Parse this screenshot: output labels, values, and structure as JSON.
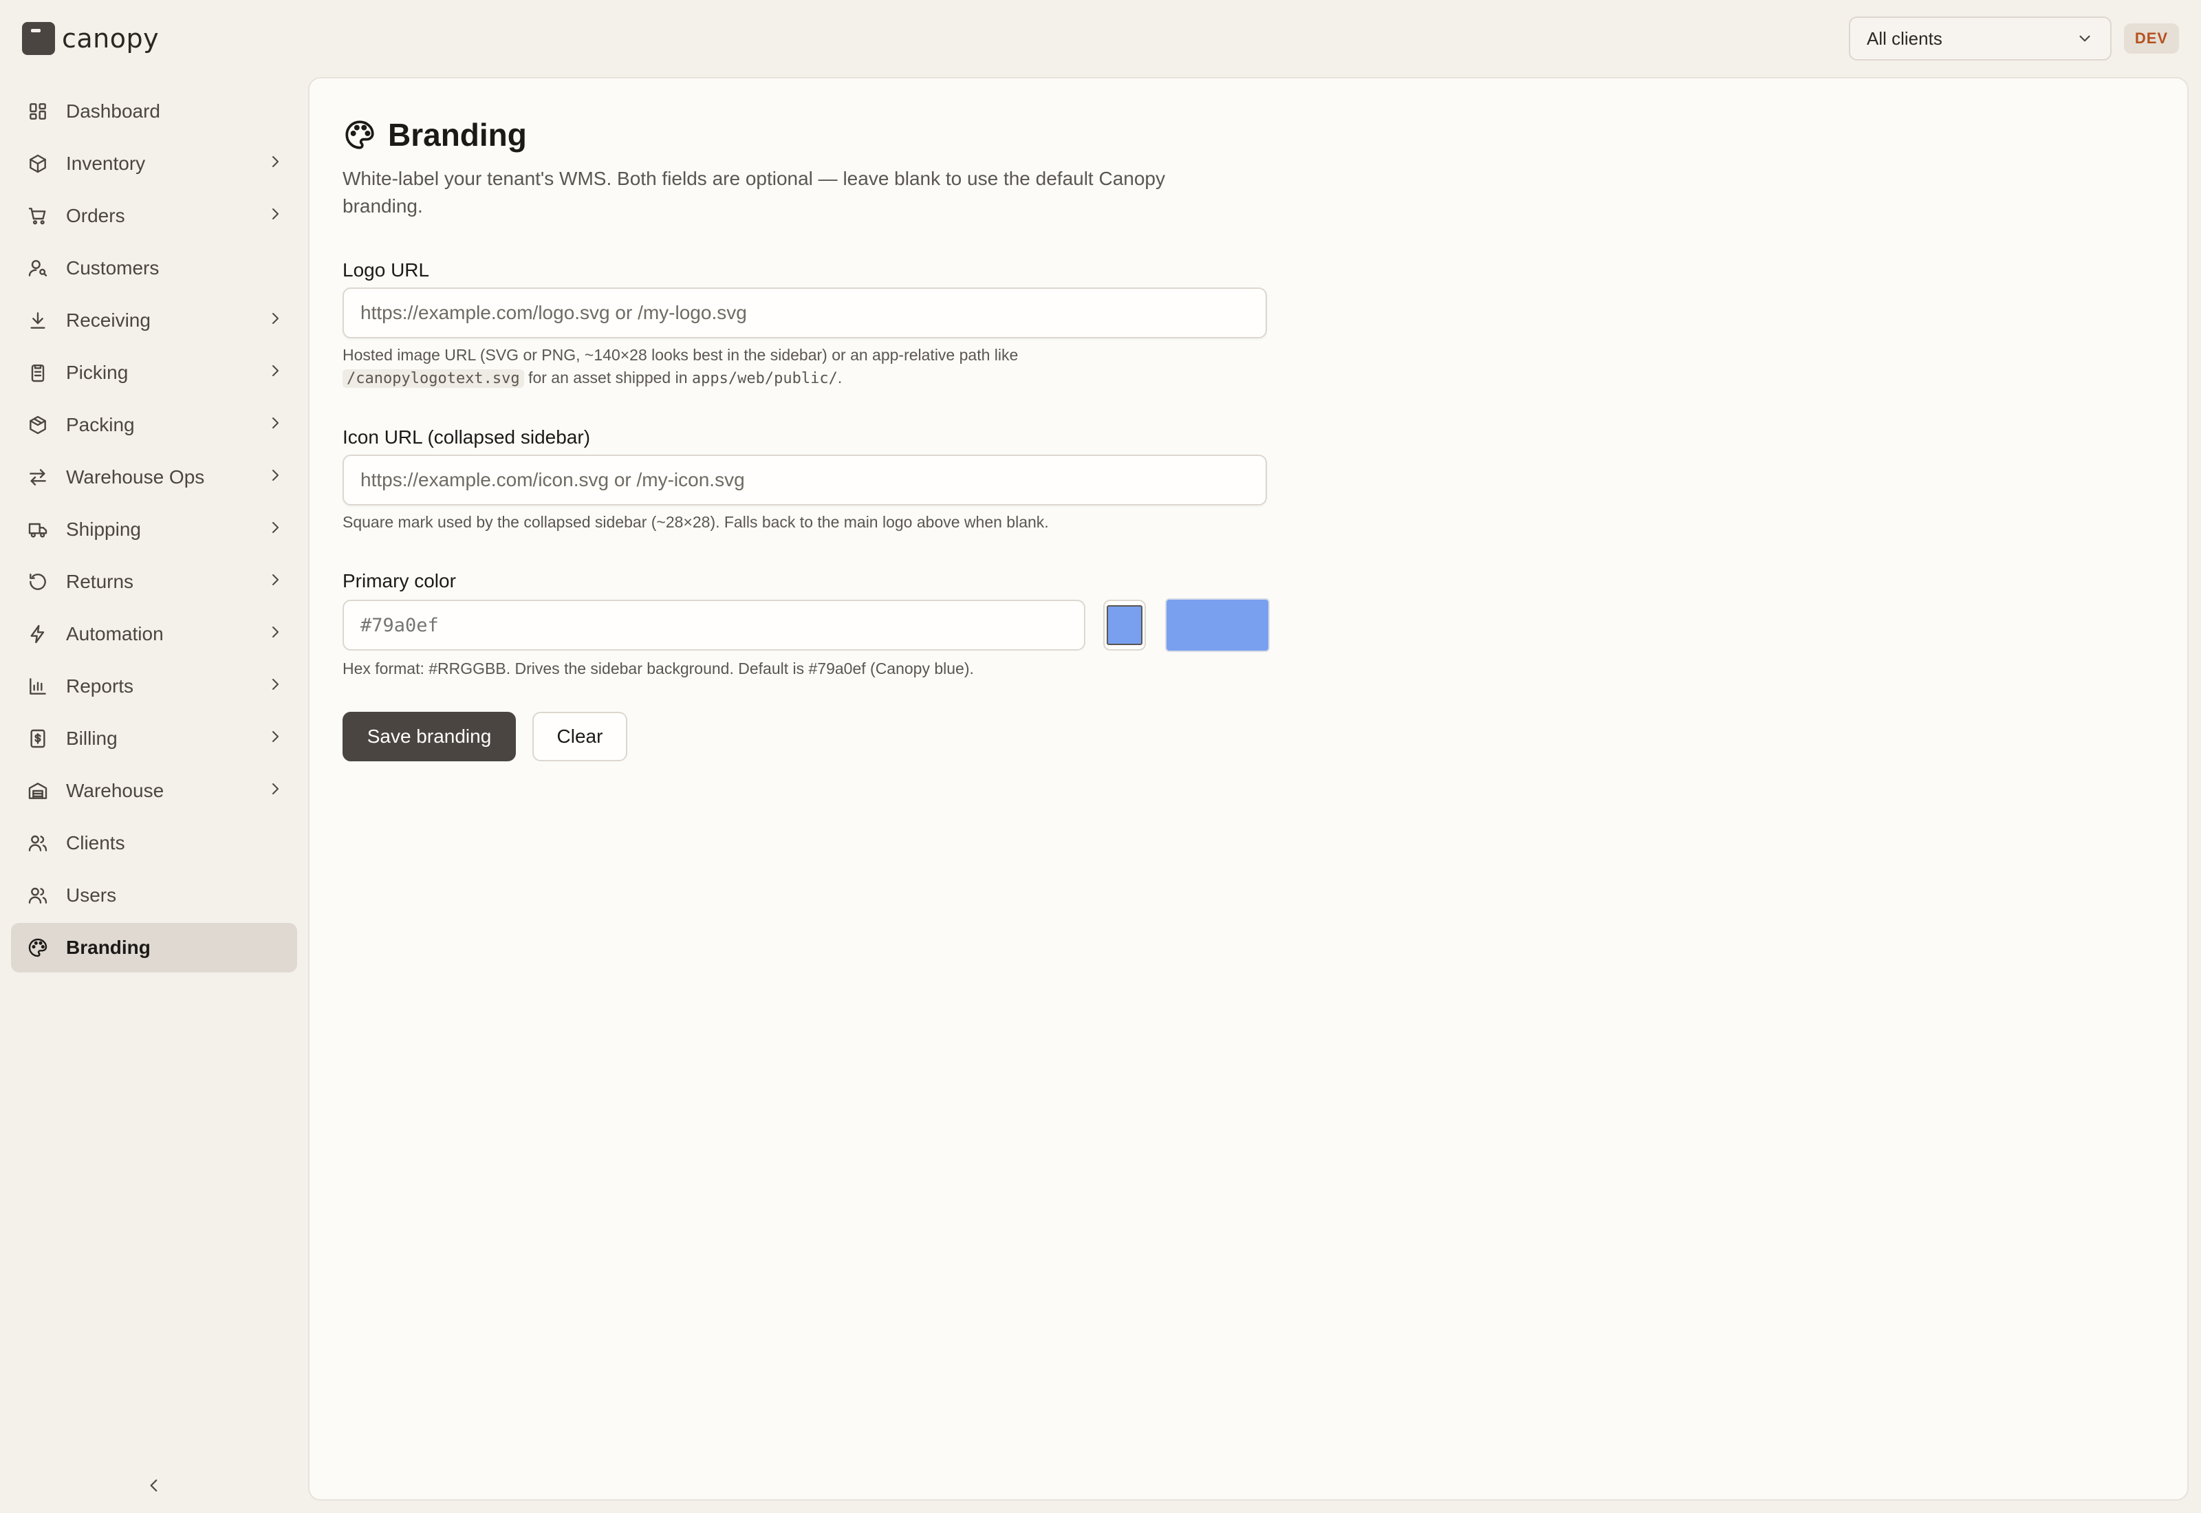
{
  "brand": {
    "name": "canopy"
  },
  "sidebar": {
    "items": [
      {
        "label": "Dashboard",
        "icon": "dashboard-icon",
        "chevron": false,
        "active": false
      },
      {
        "label": "Inventory",
        "icon": "box-icon",
        "chevron": true,
        "active": false
      },
      {
        "label": "Orders",
        "icon": "cart-icon",
        "chevron": true,
        "active": false
      },
      {
        "label": "Customers",
        "icon": "customer-icon",
        "chevron": false,
        "active": false
      },
      {
        "label": "Receiving",
        "icon": "download-icon",
        "chevron": true,
        "active": false
      },
      {
        "label": "Picking",
        "icon": "clipboard-icon",
        "chevron": true,
        "active": false
      },
      {
        "label": "Packing",
        "icon": "package-icon",
        "chevron": true,
        "active": false
      },
      {
        "label": "Warehouse Ops",
        "icon": "arrows-icon",
        "chevron": true,
        "active": false
      },
      {
        "label": "Shipping",
        "icon": "truck-icon",
        "chevron": true,
        "active": false
      },
      {
        "label": "Returns",
        "icon": "rotate-ccw-icon",
        "chevron": true,
        "active": false
      },
      {
        "label": "Automation",
        "icon": "bolt-icon",
        "chevron": true,
        "active": false
      },
      {
        "label": "Reports",
        "icon": "bar-chart-icon",
        "chevron": true,
        "active": false
      },
      {
        "label": "Billing",
        "icon": "receipt-icon",
        "chevron": true,
        "active": false
      },
      {
        "label": "Warehouse",
        "icon": "warehouse-icon",
        "chevron": true,
        "active": false
      },
      {
        "label": "Clients",
        "icon": "users-icon",
        "chevron": false,
        "active": false
      },
      {
        "label": "Users",
        "icon": "users-icon",
        "chevron": false,
        "active": false
      },
      {
        "label": "Branding",
        "icon": "palette-icon",
        "chevron": false,
        "active": true
      }
    ],
    "collapse_icon": "chevron-left-icon"
  },
  "header": {
    "client_select": "All clients",
    "env_badge": "DEV"
  },
  "page": {
    "title": "Branding",
    "title_icon": "palette-icon",
    "description": "White-label your tenant's WMS. Both fields are optional — leave blank to use the default Canopy branding."
  },
  "form": {
    "logo": {
      "label": "Logo URL",
      "placeholder": "https://example.com/logo.svg or /my-logo.svg",
      "hint_before": "Hosted image URL (SVG or PNG, ~140×28 looks best in the sidebar) or an app-relative path like",
      "hint_code1": "/canopylogotext.svg",
      "hint_middle": "for an asset shipped in",
      "hint_code2": "apps/web/public/",
      "hint_after": "."
    },
    "icon": {
      "label": "Icon URL (collapsed sidebar)",
      "placeholder": "https://example.com/icon.svg or /my-icon.svg",
      "hint": "Square mark used by the collapsed sidebar (~28×28). Falls back to the main logo above when blank."
    },
    "color": {
      "label": "Primary color",
      "placeholder": "#79a0ef",
      "value_color": "#79a0ef",
      "preview_color": "#79a0ef",
      "hint": "Hex format: #RRGGBB. Drives the sidebar background. Default is #79a0ef (Canopy blue)."
    },
    "save_label": "Save branding",
    "clear_label": "Clear"
  }
}
